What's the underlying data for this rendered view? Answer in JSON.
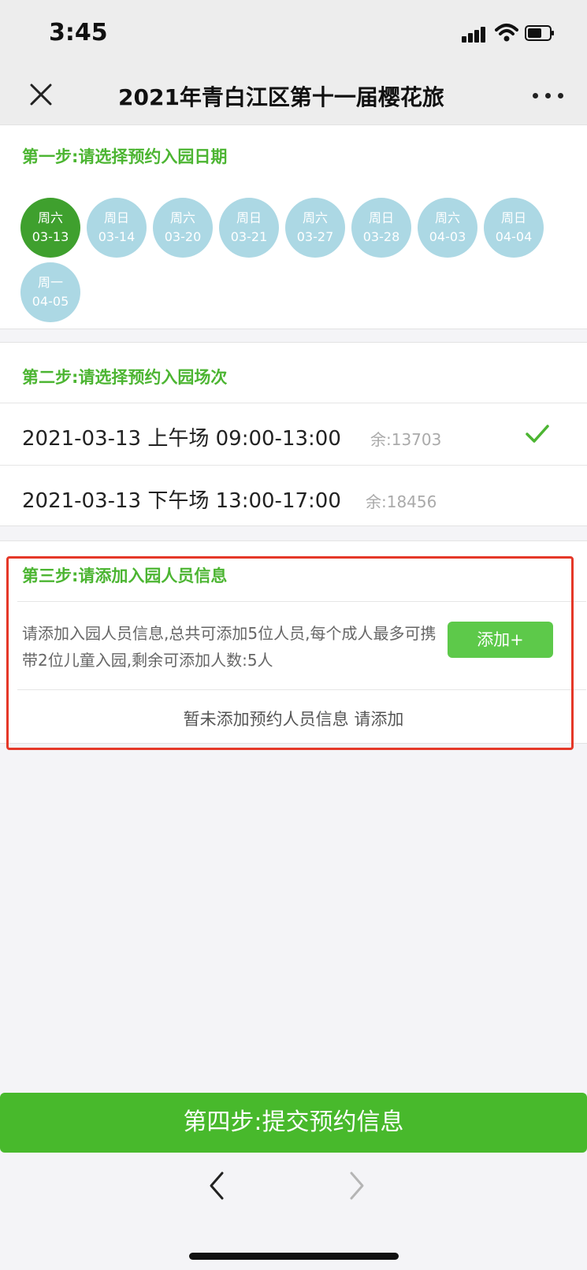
{
  "status_bar": {
    "time": "3:45"
  },
  "header": {
    "title": "2021年青白江区第十一届樱花旅"
  },
  "step1": {
    "title": "第一步:请选择预约入园日期",
    "dates": [
      {
        "weekday": "周六",
        "date": "03-13",
        "selected": true
      },
      {
        "weekday": "周日",
        "date": "03-14",
        "selected": false
      },
      {
        "weekday": "周六",
        "date": "03-20",
        "selected": false
      },
      {
        "weekday": "周日",
        "date": "03-21",
        "selected": false
      },
      {
        "weekday": "周六",
        "date": "03-27",
        "selected": false
      },
      {
        "weekday": "周日",
        "date": "03-28",
        "selected": false
      },
      {
        "weekday": "周六",
        "date": "04-03",
        "selected": false
      },
      {
        "weekday": "周日",
        "date": "04-04",
        "selected": false
      },
      {
        "weekday": "周一",
        "date": "04-05",
        "selected": false
      }
    ]
  },
  "step2": {
    "title": "第二步:请选择预约入园场次",
    "sessions": [
      {
        "label": "2021-03-13 上午场 09:00-13:00",
        "remaining": "余:13703",
        "selected": true
      },
      {
        "label": "2021-03-13 下午场 13:00-17:00",
        "remaining": "余:18456",
        "selected": false
      }
    ]
  },
  "step3": {
    "title": "第三步:请添加入园人员信息",
    "description": "请添加入园人员信息,总共可添加5位人员,每个成人最多可携带2位儿童入园,剩余可添加人数:5人",
    "add_button": "添加+",
    "empty_text": "暂未添加预约人员信息 请添加"
  },
  "submit_button": "第四步:提交预约信息",
  "colors": {
    "accent_green": "#48b92c",
    "selected_date": "#3fa02e",
    "date_bg": "#acd8e4",
    "highlight_red": "#e53828"
  },
  "icons": [
    "close-icon",
    "more-icon",
    "check-icon",
    "back-arrow-icon",
    "forward-arrow-icon",
    "signal-icon",
    "wifi-icon",
    "battery-icon"
  ]
}
